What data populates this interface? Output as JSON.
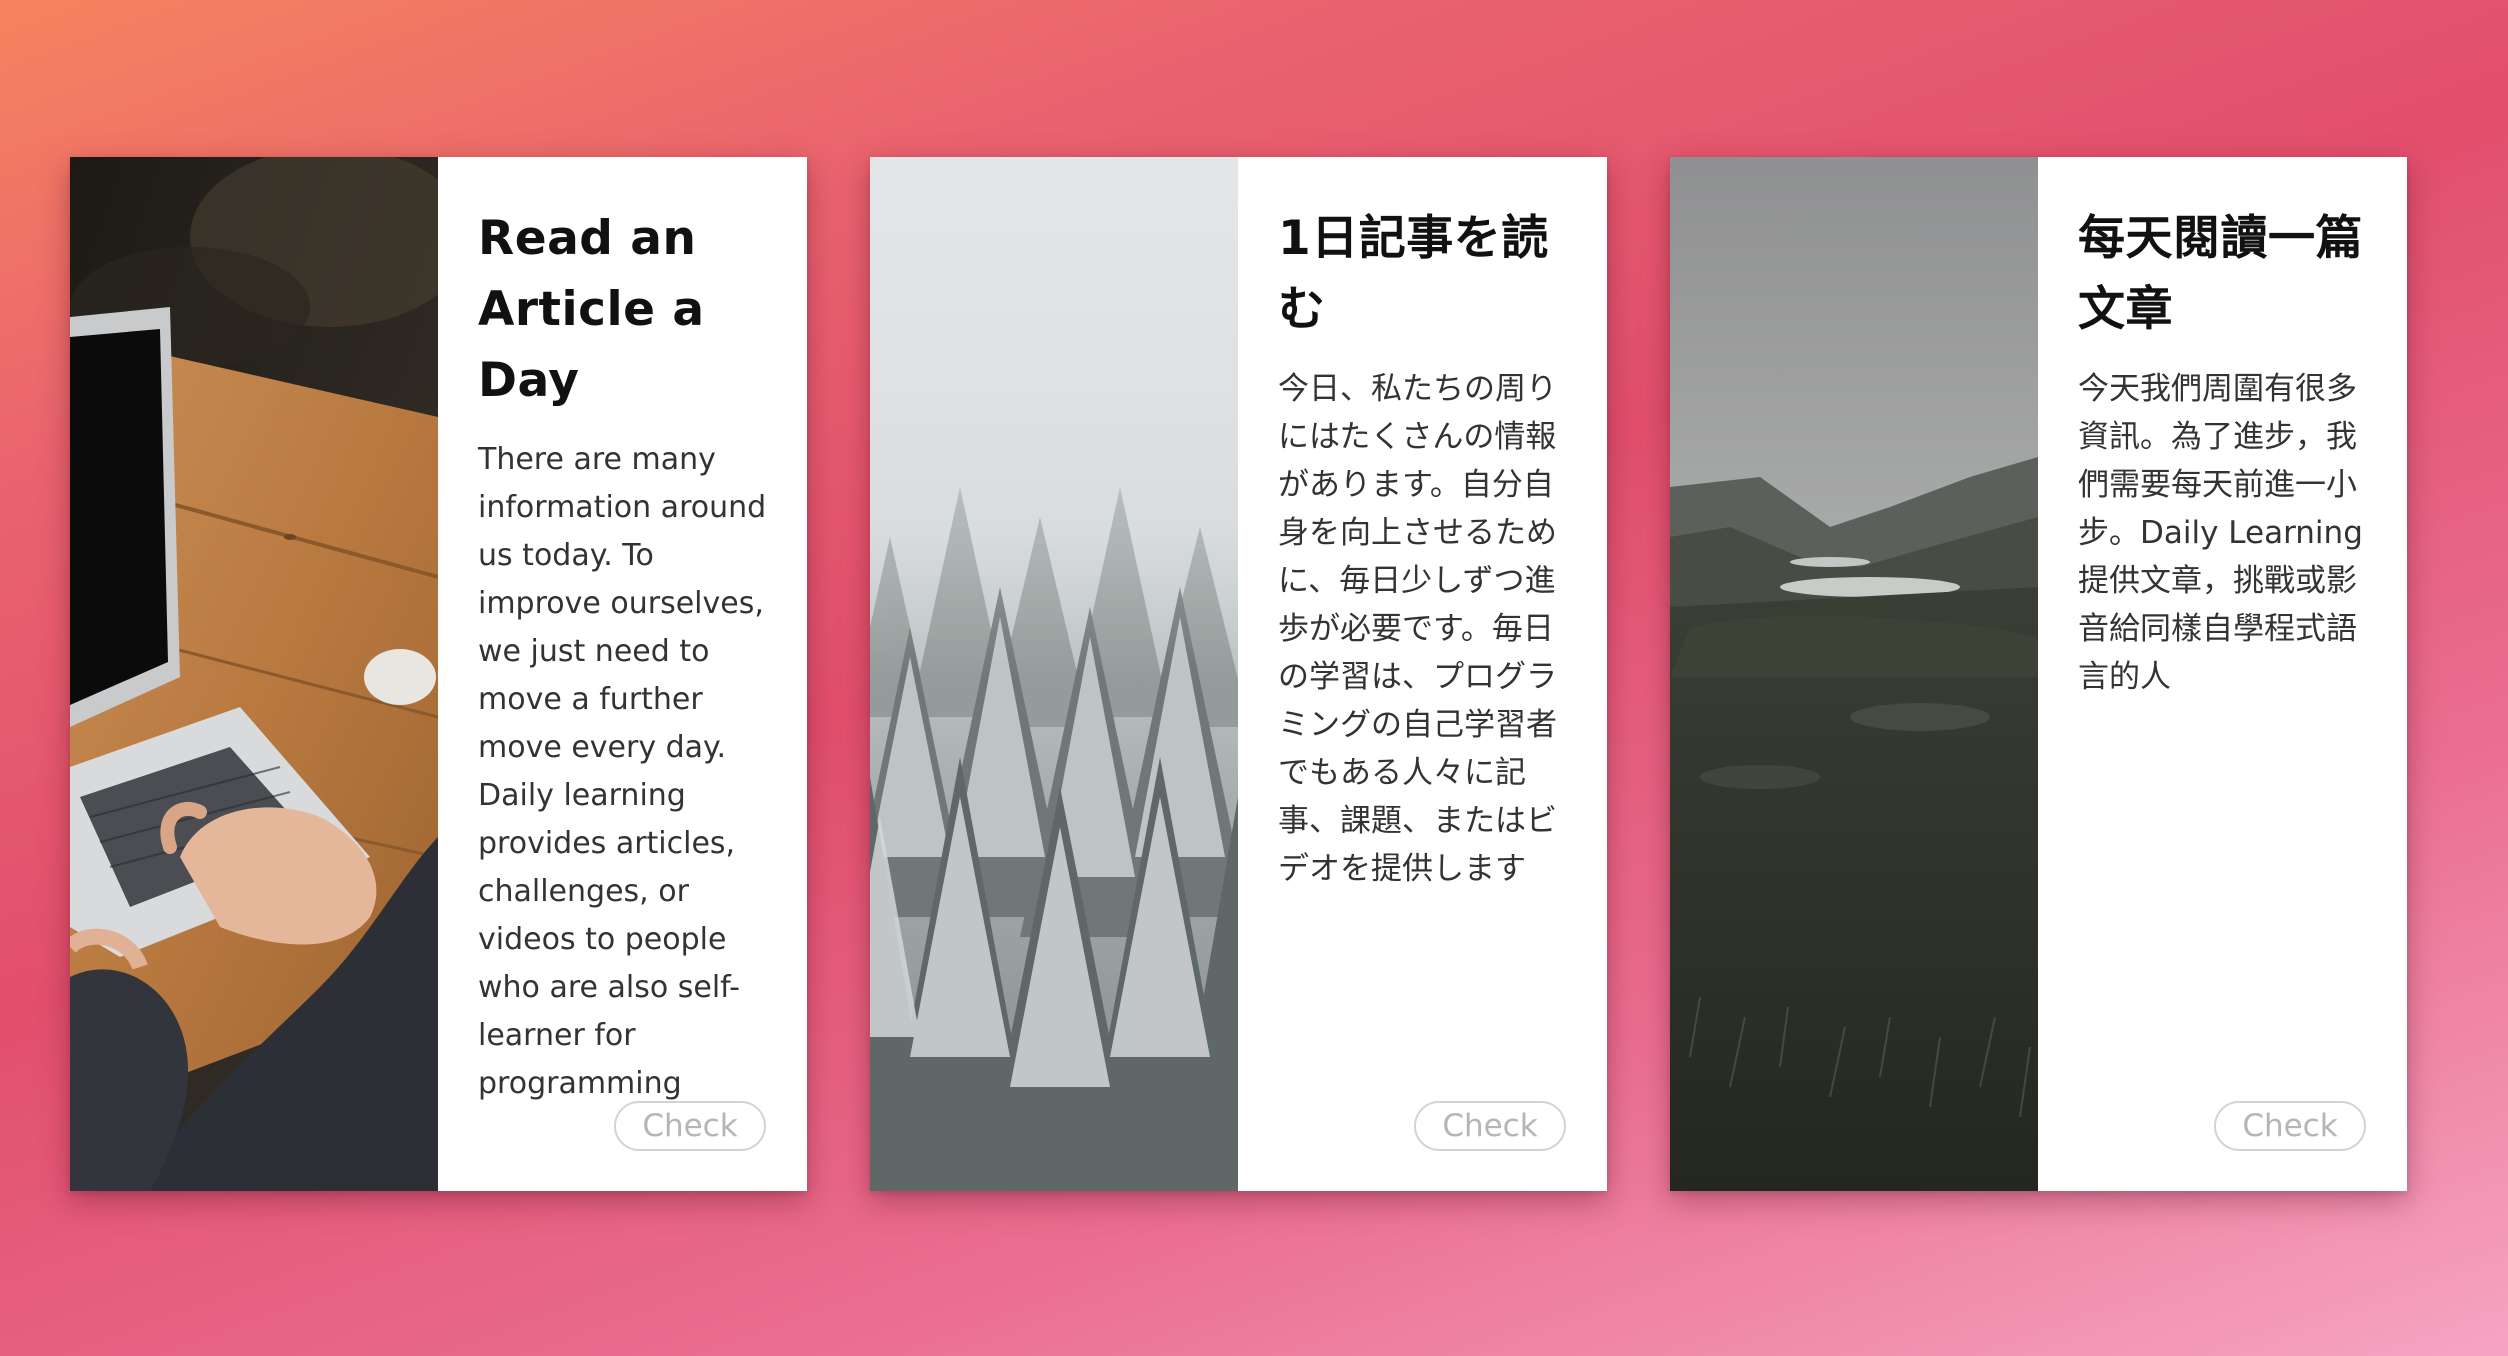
{
  "cards": [
    {
      "title": "Read an Article a Day",
      "text": "There are many information around us today. To improve ourselves, we just need to move a further move every day. Daily learning provides articles, challenges, or videos to people who are also self-learner for programming",
      "button_label": "Check",
      "image_subject": "laptop on wooden desk"
    },
    {
      "title": "1日記事を読む",
      "text": "今日、私たちの周りにはたくさんの情報があります。自分自身を向上させるために、毎日少しずつ進歩が必要です。毎日の学習は、プログラミングの自己学習者でもある人々に記事、課題、またはビデオを提供します",
      "button_label": "Check",
      "image_subject": "snowy pine forest"
    },
    {
      "title": "每天閱讀一篇文章",
      "text": "今天我們周圍有很多資訊。為了進步，我們需要每天前進一小步。Daily Learning提供文章，挑戰或影音給同樣自學程式語言的人",
      "button_label": "Check",
      "image_subject": "misty mountain valley with lake"
    }
  ],
  "colors": {
    "background_start": "#f6835f",
    "background_mid": "#e24f6d",
    "background_end": "#f6a4c2",
    "card": "#ffffff",
    "button_border": "#d3d3d3",
    "button_text": "#b5b5b5"
  }
}
